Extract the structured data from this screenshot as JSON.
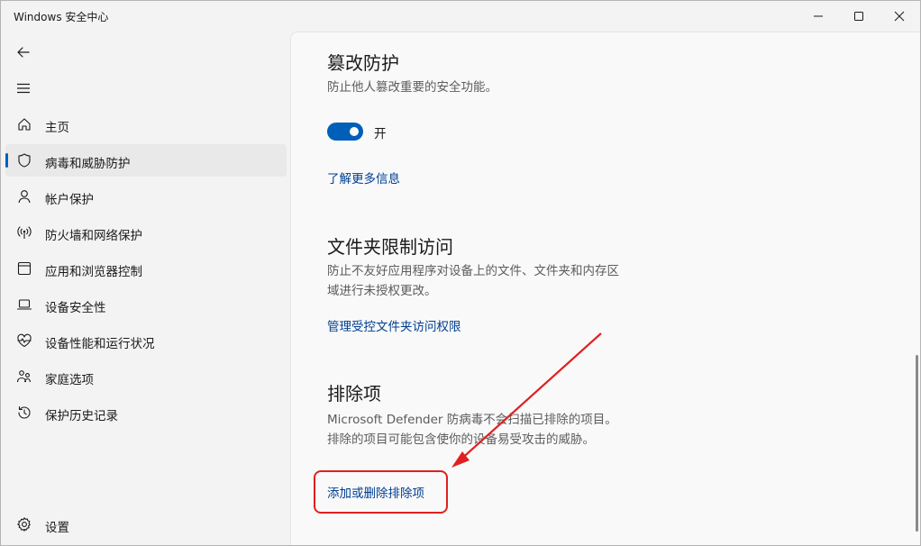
{
  "window": {
    "title": "Windows 安全中心",
    "controls": [
      "minimize-icon",
      "maximize-icon",
      "close-icon"
    ]
  },
  "sidebar": {
    "back_icon": "back-arrow-icon",
    "menu_icon": "hamburger-menu-icon",
    "items": [
      {
        "label": "主页",
        "icon": "home-icon"
      },
      {
        "label": "病毒和威胁防护",
        "icon": "shield-icon",
        "selected": true
      },
      {
        "label": "帐户保护",
        "icon": "person-icon"
      },
      {
        "label": "防火墙和网络保护",
        "icon": "wireless-signal-icon"
      },
      {
        "label": "应用和浏览器控制",
        "icon": "app-window-icon"
      },
      {
        "label": "设备安全性",
        "icon": "laptop-icon"
      },
      {
        "label": "设备性能和运行状况",
        "icon": "heart-pulse-icon"
      },
      {
        "label": "家庭选项",
        "icon": "family-icon"
      },
      {
        "label": "保护历史记录",
        "icon": "history-icon"
      }
    ],
    "settings": {
      "label": "设置",
      "icon": "gear-icon"
    }
  },
  "content": {
    "tamper": {
      "title": "篡改防护",
      "description": "防止他人篡改重要的安全功能。",
      "toggle_state": "开",
      "toggle_on": true,
      "link": "了解更多信息"
    },
    "folder_access": {
      "title": "文件夹限制访问",
      "description": "防止不友好应用程序对设备上的文件、文件夹和内存区域进行未授权更改。",
      "link": "管理受控文件夹访问权限"
    },
    "exclusions": {
      "title": "排除项",
      "description": "Microsoft Defender 防病毒不会扫描已排除的项目。排除的项目可能包含使你的设备易受攻击的威胁。",
      "link": "添加或删除排除项"
    }
  },
  "colors": {
    "accent": "#005fb8",
    "link": "#003e92",
    "annotation": "#e02020"
  }
}
